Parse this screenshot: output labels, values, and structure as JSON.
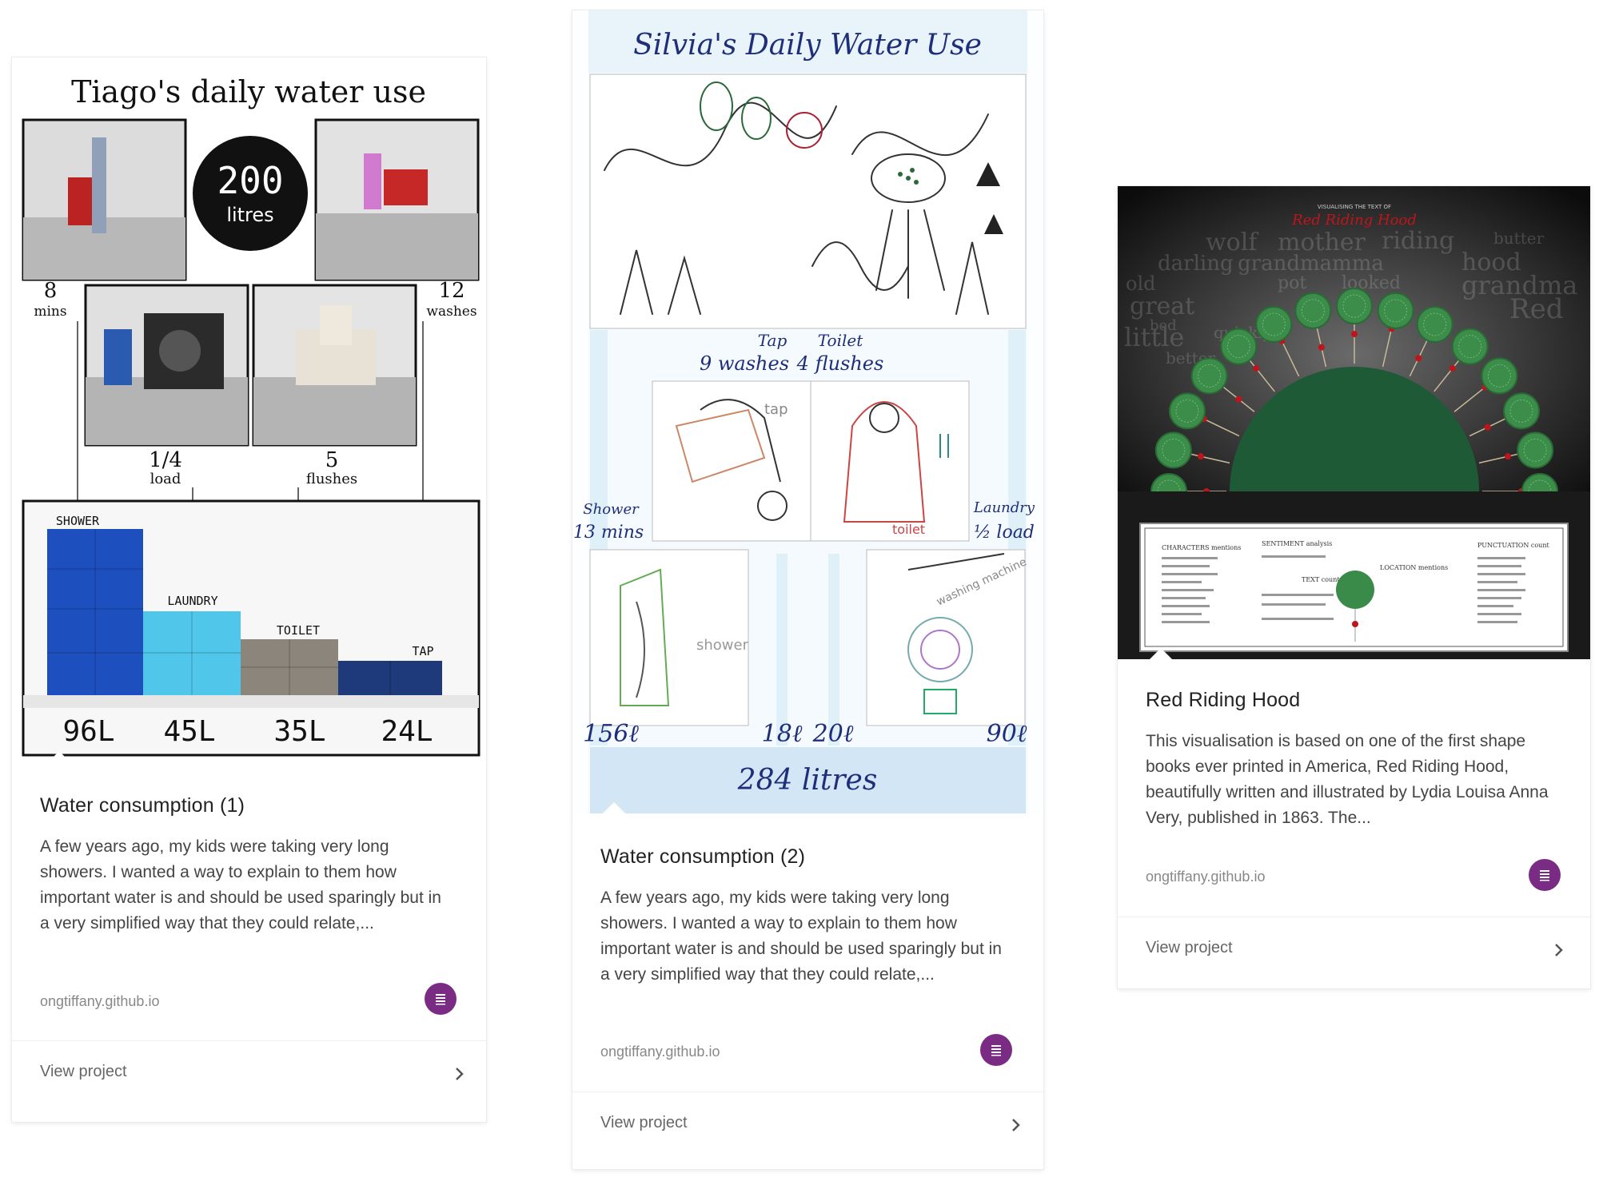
{
  "cards": [
    {
      "title": "Water consumption (1)",
      "description": "A few years ago, my kids were taking very long showers. I wanted a way to explain to them how important water is and should be used sparingly but in a very simplified way that they could relate,...",
      "source": "ongtiffany.github.io",
      "view_label": "View project",
      "thumb": {
        "heading": "Tiago's daily water use",
        "total_number": "200",
        "total_unit": "litres",
        "label_shower_time": "8",
        "label_shower_time_unit": "mins",
        "label_tap_count": "12",
        "label_tap_count_unit": "washes",
        "label_laundry_load": "1/4",
        "label_laundry_load_unit": "load",
        "label_toilet_flush": "5",
        "label_toilet_flush_unit": "flushes",
        "bars": [
          {
            "label": "SHOWER",
            "value": "96L"
          },
          {
            "label": "LAUNDRY",
            "value": "45L"
          },
          {
            "label": "TOILET",
            "value": "35L"
          },
          {
            "label": "TAP",
            "value": "24L"
          }
        ]
      }
    },
    {
      "title": "Water consumption (2)",
      "description": "A few years ago, my kids were taking very long showers. I wanted a way to explain to them how important water is and should be used sparingly but in a very simplified way that they could relate,...",
      "source": "ongtiffany.github.io",
      "view_label": "View project",
      "thumb": {
        "heading": "Silvia's Daily Water Use",
        "tap_label": "Tap",
        "tap_value": "9 washes",
        "toilet_label": "Toilet",
        "toilet_value": "4 flushes",
        "shower_label": "Shower",
        "shower_value": "13 mins",
        "laundry_label": "Laundry",
        "laundry_value": "½ load",
        "sketch_tap_caption": "tap",
        "sketch_toilet_caption": "toilet",
        "sketch_shower_caption": "shower",
        "sketch_laundry_caption": "washing machine",
        "values": [
          "156ℓ",
          "18ℓ",
          "20ℓ",
          "90ℓ"
        ],
        "total": "284 litres"
      }
    },
    {
      "title": "Red Riding Hood",
      "description": "This visualisation is based on one of the first shape books ever printed in America, Red Riding Hood, beautifully written and illustrated by Lydia Louisa Anna Very, published in 1863. The...",
      "source": "ongtiffany.github.io",
      "view_label": "View project",
      "thumb": {
        "kicker": "VISUALISING THE TEXT OF",
        "heading": "Red Riding Hood",
        "cloud_words": [
          "wolf",
          "mother",
          "riding",
          "butter",
          "darling",
          "grandmamma",
          "hood",
          "old",
          "pot",
          "looked",
          "great",
          "grandma",
          "Red",
          "little",
          "quickly",
          "bed",
          "better"
        ],
        "legend_titles": [
          "CHARACTERS mentions",
          "SENTIMENT analysis",
          "TEXT count",
          "LOCATION mentions",
          "PUNCTUATION count"
        ]
      }
    }
  ],
  "colors": {
    "source_icon": "#7a2c84",
    "lego_dark_blue": "#1d4fbf",
    "lego_light_blue": "#4fc6ea",
    "lego_grey": "#8b857c",
    "lego_navy": "#1e3a7a",
    "sketch_ink": "#1f2e7a",
    "rrh_green": "#1f5a36",
    "rrh_red": "#c0141c"
  },
  "icons": {
    "source": "list-icon",
    "view": "chevron-right-icon"
  }
}
